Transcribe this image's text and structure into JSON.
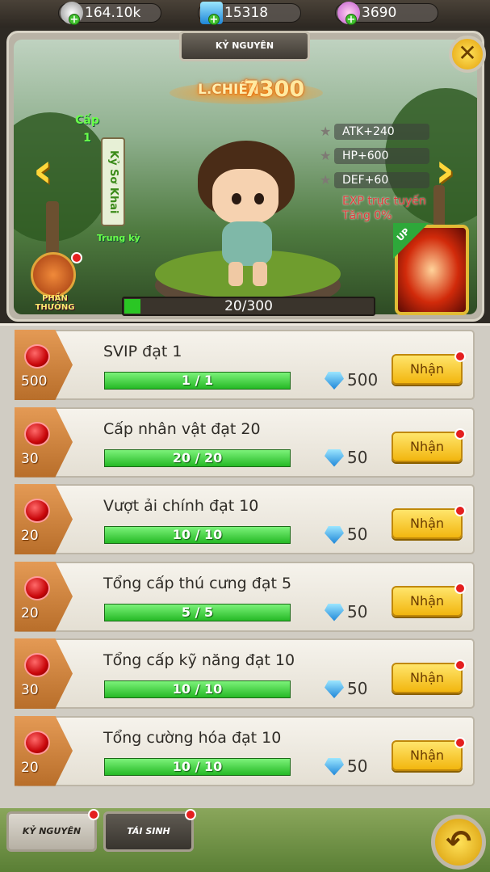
{
  "resources": [
    {
      "name": "silver",
      "value": "164.10k",
      "icon": "silver-coin-icon"
    },
    {
      "name": "diamond",
      "value": "15318",
      "icon": "blue-diamond-icon"
    },
    {
      "name": "shell",
      "value": "3690",
      "icon": "pink-shell-icon"
    }
  ],
  "header": {
    "title": "KỶ NGUYÊN"
  },
  "hero": {
    "power_label": "L.CHIẾN",
    "power_value": "7300",
    "level_label": "Cấp",
    "level_value": "1",
    "era_name": "Kỷ Sơ Khai",
    "rank": "Trung kỳ",
    "stats": [
      "ATK+240",
      "HP+600",
      "DEF+60"
    ],
    "exp_info_1": "EXP trực tuyến",
    "exp_info_2": "Tăng 0%",
    "reward_label": "PHẦN THƯỞNG",
    "up_label": "UP",
    "exp_text": "20/300",
    "exp_fraction": 0.0667
  },
  "quests": [
    {
      "title": "SVIP đạt 1",
      "progress": "1 / 1",
      "fraction": 1,
      "gem_reward": "500",
      "diamond_reward": "500",
      "button": "Nhận"
    },
    {
      "title": "Cấp nhân vật đạt 20",
      "progress": "20 / 20",
      "fraction": 1,
      "gem_reward": "30",
      "diamond_reward": "50",
      "button": "Nhận"
    },
    {
      "title": "Vượt ải chính đạt 10",
      "progress": "10 / 10",
      "fraction": 1,
      "gem_reward": "20",
      "diamond_reward": "50",
      "button": "Nhận"
    },
    {
      "title": "Tổng cấp thú cưng đạt 5",
      "progress": "5 / 5",
      "fraction": 1,
      "gem_reward": "20",
      "diamond_reward": "50",
      "button": "Nhận"
    },
    {
      "title": "Tổng cấp kỹ năng đạt 10",
      "progress": "10 / 10",
      "fraction": 1,
      "gem_reward": "30",
      "diamond_reward": "50",
      "button": "Nhận"
    },
    {
      "title": "Tổng cường hóa đạt 10",
      "progress": "10 / 10",
      "fraction": 1,
      "gem_reward": "20",
      "diamond_reward": "50",
      "button": "Nhận"
    }
  ],
  "tabs": [
    {
      "label": "KỶ NGUYÊN",
      "active": true
    },
    {
      "label": "TÁI SINH",
      "active": false
    }
  ],
  "colors": {
    "accent_green": "#2ac624",
    "claim_yellow": "#f2b60f",
    "notify_red": "#e41f1f"
  }
}
